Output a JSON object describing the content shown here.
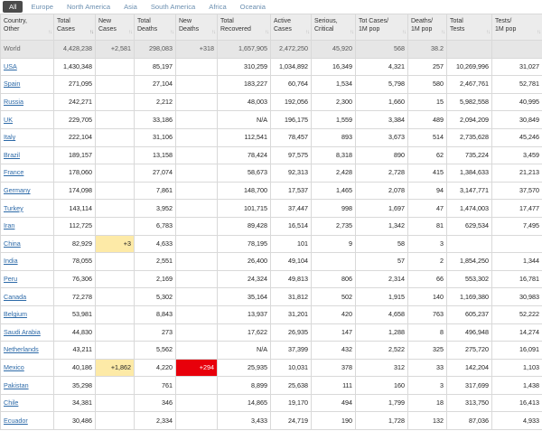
{
  "tabs": [
    "All",
    "Europe",
    "North America",
    "Asia",
    "South America",
    "Africa",
    "Oceania"
  ],
  "active_tab": "All",
  "headers": [
    {
      "l1": "Country,",
      "l2": "Other"
    },
    {
      "l1": "Total",
      "l2": "Cases"
    },
    {
      "l1": "New",
      "l2": "Cases"
    },
    {
      "l1": "Total",
      "l2": "Deaths"
    },
    {
      "l1": "New",
      "l2": "Deaths"
    },
    {
      "l1": "Total",
      "l2": "Recovered"
    },
    {
      "l1": "Active",
      "l2": "Cases"
    },
    {
      "l1": "Serious,",
      "l2": "Critical"
    },
    {
      "l1": "Tot Cases/",
      "l2": "1M pop"
    },
    {
      "l1": "Deaths/",
      "l2": "1M pop"
    },
    {
      "l1": "Total",
      "l2": "Tests"
    },
    {
      "l1": "Tests/",
      "l2": "1M pop"
    }
  ],
  "world": [
    "World",
    "4,428,238",
    "+2,581",
    "298,083",
    "+318",
    "1,657,905",
    "2,472,250",
    "45,920",
    "568",
    "38.2",
    "",
    ""
  ],
  "rows": [
    [
      "USA",
      "1,430,348",
      "",
      "85,197",
      "",
      "310,259",
      "1,034,892",
      "16,349",
      "4,321",
      "257",
      "10,269,996",
      "31,027"
    ],
    [
      "Spain",
      "271,095",
      "",
      "27,104",
      "",
      "183,227",
      "60,764",
      "1,534",
      "5,798",
      "580",
      "2,467,761",
      "52,781"
    ],
    [
      "Russia",
      "242,271",
      "",
      "2,212",
      "",
      "48,003",
      "192,056",
      "2,300",
      "1,660",
      "15",
      "5,982,558",
      "40,995"
    ],
    [
      "UK",
      "229,705",
      "",
      "33,186",
      "",
      "N/A",
      "196,175",
      "1,559",
      "3,384",
      "489",
      "2,094,209",
      "30,849"
    ],
    [
      "Italy",
      "222,104",
      "",
      "31,106",
      "",
      "112,541",
      "78,457",
      "893",
      "3,673",
      "514",
      "2,735,628",
      "45,246"
    ],
    [
      "Brazil",
      "189,157",
      "",
      "13,158",
      "",
      "78,424",
      "97,575",
      "8,318",
      "890",
      "62",
      "735,224",
      "3,459"
    ],
    [
      "France",
      "178,060",
      "",
      "27,074",
      "",
      "58,673",
      "92,313",
      "2,428",
      "2,728",
      "415",
      "1,384,633",
      "21,213"
    ],
    [
      "Germany",
      "174,098",
      "",
      "7,861",
      "",
      "148,700",
      "17,537",
      "1,465",
      "2,078",
      "94",
      "3,147,771",
      "37,570"
    ],
    [
      "Turkey",
      "143,114",
      "",
      "3,952",
      "",
      "101,715",
      "37,447",
      "998",
      "1,697",
      "47",
      "1,474,003",
      "17,477"
    ],
    [
      "Iran",
      "112,725",
      "",
      "6,783",
      "",
      "89,428",
      "16,514",
      "2,735",
      "1,342",
      "81",
      "629,534",
      "7,495"
    ],
    [
      "China",
      "82,929",
      "+3",
      "4,633",
      "",
      "78,195",
      "101",
      "9",
      "58",
      "3",
      "",
      ""
    ],
    [
      "India",
      "78,055",
      "",
      "2,551",
      "",
      "26,400",
      "49,104",
      "",
      "57",
      "2",
      "1,854,250",
      "1,344"
    ],
    [
      "Peru",
      "76,306",
      "",
      "2,169",
      "",
      "24,324",
      "49,813",
      "806",
      "2,314",
      "66",
      "553,302",
      "16,781"
    ],
    [
      "Canada",
      "72,278",
      "",
      "5,302",
      "",
      "35,164",
      "31,812",
      "502",
      "1,915",
      "140",
      "1,169,380",
      "30,983"
    ],
    [
      "Belgium",
      "53,981",
      "",
      "8,843",
      "",
      "13,937",
      "31,201",
      "420",
      "4,658",
      "763",
      "605,237",
      "52,222"
    ],
    [
      "Saudi Arabia",
      "44,830",
      "",
      "273",
      "",
      "17,622",
      "26,935",
      "147",
      "1,288",
      "8",
      "496,948",
      "14,274"
    ],
    [
      "Netherlands",
      "43,211",
      "",
      "5,562",
      "",
      "N/A",
      "37,399",
      "432",
      "2,522",
      "325",
      "275,720",
      "16,091"
    ],
    [
      "Mexico",
      "40,186",
      "+1,862",
      "4,220",
      "+294",
      "25,935",
      "10,031",
      "378",
      "312",
      "33",
      "142,204",
      "1,103"
    ],
    [
      "Pakistan",
      "35,298",
      "",
      "761",
      "",
      "8,899",
      "25,638",
      "111",
      "160",
      "3",
      "317,699",
      "1,438"
    ],
    [
      "Chile",
      "34,381",
      "",
      "346",
      "",
      "14,865",
      "19,170",
      "494",
      "1,799",
      "18",
      "313,750",
      "16,413"
    ],
    [
      "Ecuador",
      "30,486",
      "",
      "2,334",
      "",
      "3,433",
      "24,719",
      "190",
      "1,728",
      "132",
      "87,036",
      "4,933"
    ]
  ],
  "colors": {
    "new_cases_bg": "#fdeaa7",
    "new_deaths_bg": "#e8000b",
    "link": "#2d6aa8",
    "tab_active_bg": "#4b4b4b",
    "tab_text": "#6b8fb0"
  },
  "sort_column": "Total Cases"
}
